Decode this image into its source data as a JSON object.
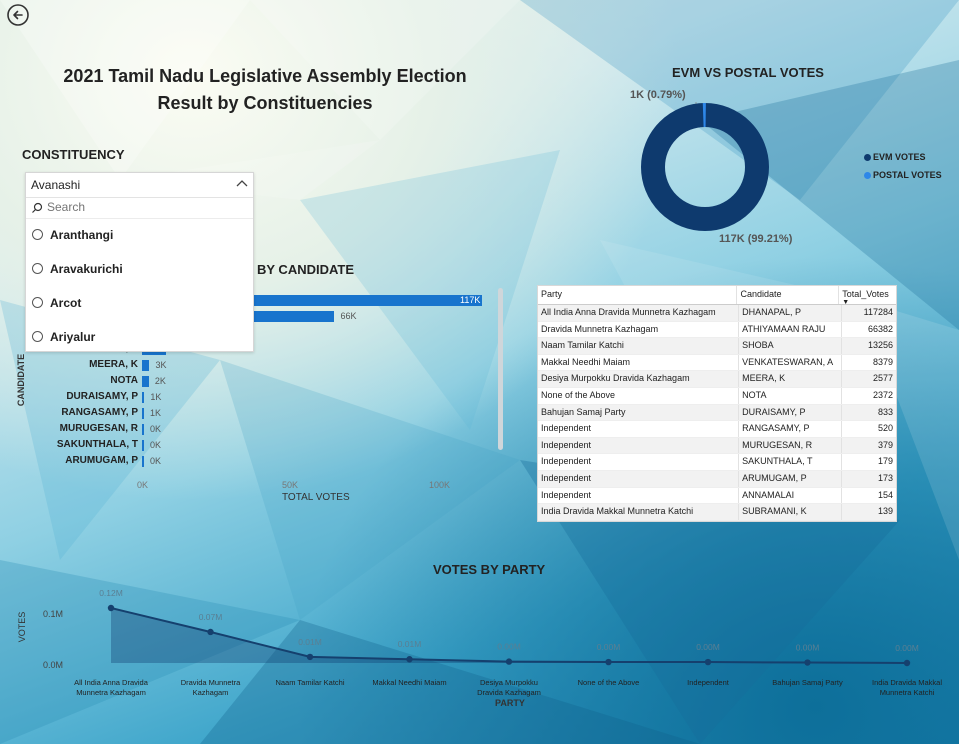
{
  "report": {
    "title_line1": "2021 Tamil Nadu Legislative Assembly Election",
    "title_line2": "Result by Constituencies"
  },
  "slicer": {
    "label": "CONSTITUENCY",
    "selected": "Avanashi",
    "search_placeholder": "Search",
    "options": [
      "Aranthangi",
      "Aravakurichi",
      "Arcot",
      "Ariyalur"
    ]
  },
  "colors": {
    "evm": "#0e3a6e",
    "postal": "#2e87e8",
    "bar": "#1874cd",
    "line": "#15406e"
  },
  "donut": {
    "title": "EVM VS POSTAL VOTES",
    "legend": [
      "EVM VOTES",
      "POSTAL VOTES"
    ],
    "postal_label": "1K (0.79%)",
    "evm_label": "117K (99.21%)"
  },
  "candidate_chart": {
    "title": "BY CANDIDATE",
    "ylabel": "CANDIDATE",
    "xlabel": "TOTAL VOTES",
    "x_ticks": [
      "0K",
      "50K",
      "100K"
    ],
    "rows": [
      {
        "name": "",
        "value": 117284,
        "label": "117K"
      },
      {
        "name": "",
        "value": 66382,
        "label": "66K"
      },
      {
        "name": "VENKATESWARAN, A",
        "value": 8379,
        "label": "8K"
      },
      {
        "name": "MEERA, K",
        "value": 2577,
        "label": "3K"
      },
      {
        "name": "NOTA",
        "value": 2372,
        "label": "2K"
      },
      {
        "name": "DURAISAMY, P",
        "value": 833,
        "label": "1K"
      },
      {
        "name": "RANGASAMY, P",
        "value": 520,
        "label": "1K"
      },
      {
        "name": "MURUGESAN, R",
        "value": 379,
        "label": "0K"
      },
      {
        "name": "SAKUNTHALA, T",
        "value": 179,
        "label": "0K"
      },
      {
        "name": "ARUMUGAM, P",
        "value": 173,
        "label": "0K"
      }
    ]
  },
  "table": {
    "headers": [
      "Party",
      "Candidate",
      "Total_Votes"
    ],
    "rows": [
      [
        "All India Anna Dravida Munnetra Kazhagam",
        "DHANAPAL, P",
        "117284"
      ],
      [
        "Dravida Munnetra Kazhagam",
        "ATHIYAMAAN RAJU",
        "66382"
      ],
      [
        "Naam Tamilar Katchi",
        "SHOBA",
        "13256"
      ],
      [
        "Makkal Needhi Maiam",
        "VENKATESWARAN, A",
        "8379"
      ],
      [
        "Desiya Murpokku Dravida Kazhagam",
        "MEERA, K",
        "2577"
      ],
      [
        "None of the Above",
        "NOTA",
        "2372"
      ],
      [
        "Bahujan Samaj Party",
        "DURAISAMY, P",
        "833"
      ],
      [
        "Independent",
        "RANGASAMY, P",
        "520"
      ],
      [
        "Independent",
        "MURUGESAN, R",
        "379"
      ],
      [
        "Independent",
        "SAKUNTHALA, T",
        "179"
      ],
      [
        "Independent",
        "ARUMUGAM, P",
        "173"
      ],
      [
        "Independent",
        "ANNAMALAI",
        "154"
      ],
      [
        "India Dravida Makkal Munnetra Katchi",
        "SUBRAMANI, K",
        "139"
      ]
    ]
  },
  "chart_data": [
    {
      "type": "pie",
      "title": "EVM VS POSTAL VOTES",
      "categories": [
        "EVM VOTES",
        "POSTAL VOTES"
      ],
      "values": [
        99.21,
        0.79
      ],
      "data_labels": [
        "117K (99.21%)",
        "1K (0.79%)"
      ],
      "legend": "right"
    },
    {
      "type": "bar",
      "title": "BY CANDIDATE",
      "xlabel": "TOTAL VOTES",
      "ylabel": "CANDIDATE",
      "categories": [
        "",
        "",
        "VENKATESWARAN, A",
        "MEERA, K",
        "NOTA",
        "DURAISAMY, P",
        "RANGASAMY, P",
        "MURUGESAN, R",
        "SAKUNTHALA, T",
        "ARUMUGAM, P"
      ],
      "values": [
        117284,
        66382,
        8379,
        2577,
        2372,
        833,
        520,
        379,
        179,
        173
      ],
      "xlim": [
        0,
        120000
      ]
    },
    {
      "type": "area",
      "title": "VOTES BY PARTY",
      "xlabel": "PARTY",
      "ylabel": "VOTES",
      "y_ticks": [
        "0.1M",
        "0.0M"
      ],
      "ylim": [
        0,
        0.13
      ],
      "categories": [
        "All India Anna Dravida Munnetra Kazhagam",
        "Dravida Munnetra Kazhagam",
        "Naam Tamilar Katchi",
        "Makkal Needhi Maiam",
        "Desiya Murpokku Dravida Kazhagam",
        "None of the Above",
        "Independent",
        "Bahujan Samaj Party",
        "India Dravida Makkal Munnetra Katchi"
      ],
      "values": [
        0.117,
        0.066,
        0.013,
        0.008,
        0.003,
        0.002,
        0.002,
        0.001,
        0.0
      ],
      "data_labels": [
        "0.12M",
        "0.07M",
        "0.01M",
        "0.01M",
        "0.00M",
        "0.00M",
        "0.00M",
        "0.00M",
        "0.00M"
      ],
      "grid": false
    }
  ],
  "party_chart": {
    "title": "VOTES BY PARTY",
    "xlabel": "PARTY",
    "ylabel": "VOTES",
    "x_tick_labels": [
      [
        "All India Anna Dravida",
        "Munnetra Kazhagam"
      ],
      [
        "Dravida Munnetra",
        "Kazhagam"
      ],
      [
        "Naam Tamilar Katchi"
      ],
      [
        "Makkal Needhi Maiam"
      ],
      [
        "Desiya Murpokku",
        "Dravida Kazhagam"
      ],
      [
        "None of the Above"
      ],
      [
        "Independent"
      ],
      [
        "Bahujan Samaj Party"
      ],
      [
        "India Dravida Makkal",
        "Munnetra Katchi"
      ]
    ]
  }
}
